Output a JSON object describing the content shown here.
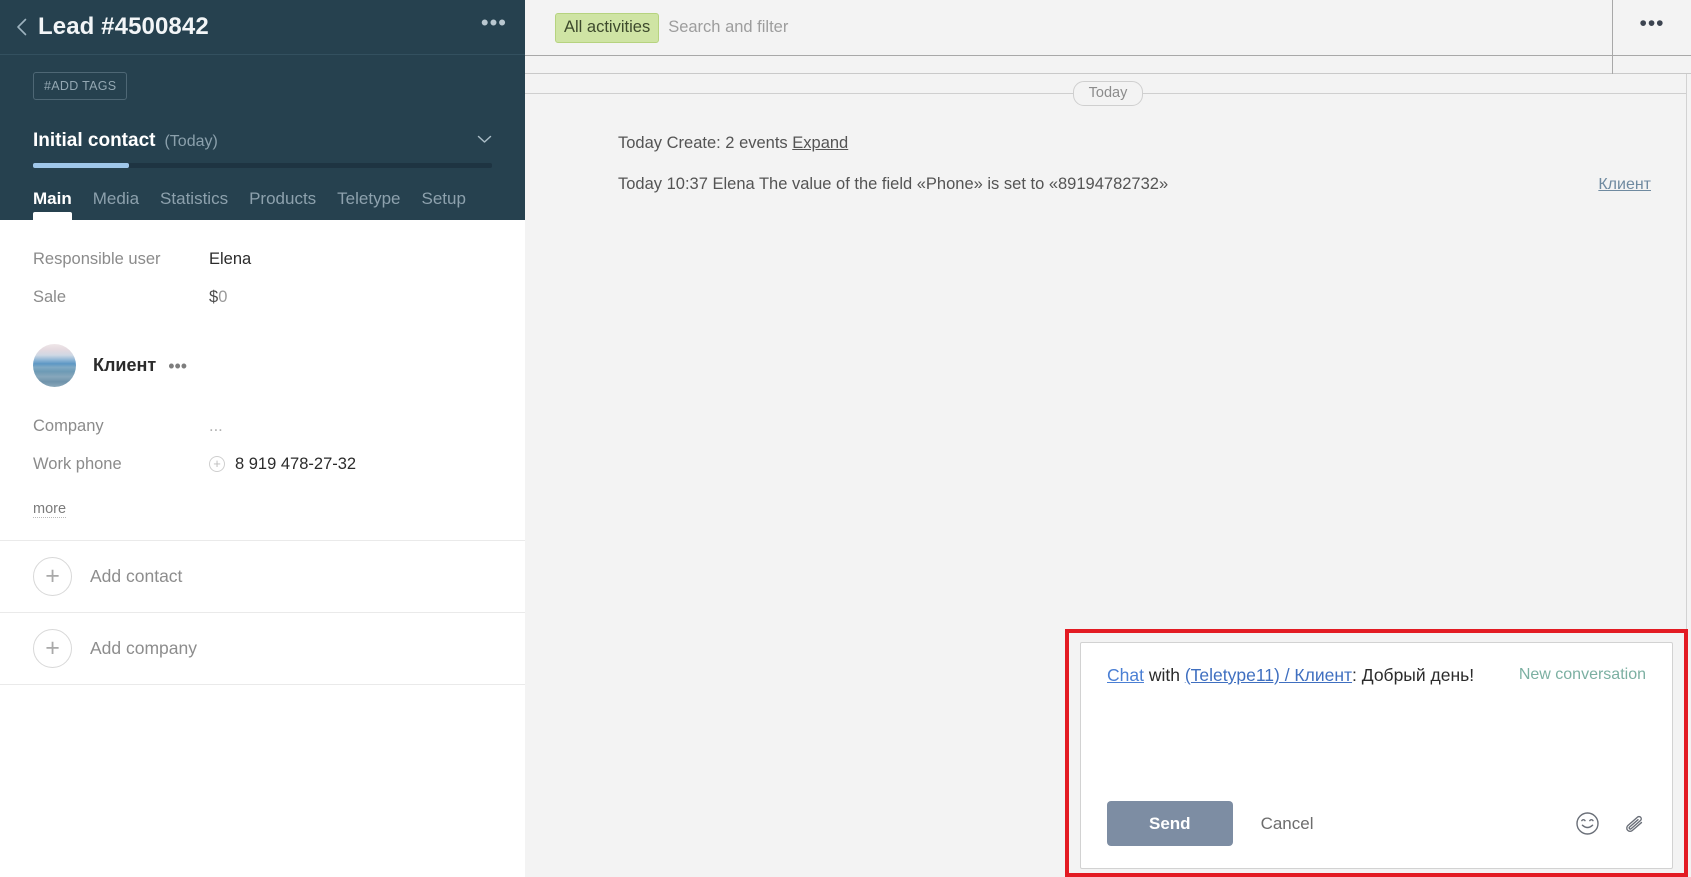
{
  "left_panel": {
    "back_icon": "chevron-left-icon",
    "title": "Lead #4500842",
    "more_dots": "•••",
    "add_tags_label": "#ADD TAGS",
    "stage": {
      "name": "Initial contact",
      "when": "(Today)",
      "chevron": "⌄",
      "progress_percent": 21
    },
    "tabs": [
      {
        "label": "Main",
        "active": true
      },
      {
        "label": "Media",
        "active": false
      },
      {
        "label": "Statistics",
        "active": false
      },
      {
        "label": "Products",
        "active": false
      },
      {
        "label": "Teletype",
        "active": false
      },
      {
        "label": "Setup",
        "active": false
      }
    ],
    "fields": [
      {
        "label": "Responsible user",
        "value": "Elena"
      },
      {
        "label": "Sale",
        "value": "$0"
      }
    ],
    "sale_currency": "$",
    "sale_amount": "0",
    "contact": {
      "name": "Клиент",
      "dots": "•••",
      "company_label": "Company",
      "company_value": "...",
      "phone_label": "Work phone",
      "phone_value": "8 919 478-27-32",
      "phone_add_icon": "plus-icon",
      "more_label": "more"
    },
    "add_contact_label": "Add contact",
    "add_company_label": "Add company",
    "plus_glyph": "+"
  },
  "topbar": {
    "filter_chip": "All activities",
    "search_placeholder": "Search and filter",
    "more_dots": "•••"
  },
  "timeline": {
    "day_pill": "Today",
    "events": [
      {
        "text": "Today Create: 2 events ",
        "link": "Expand",
        "right_link": ""
      },
      {
        "text": "Today 10:37 Elena The value of the field «Phone» is set to «89194782732»",
        "link": "",
        "right_link": "Клиент"
      }
    ]
  },
  "composer": {
    "chat_link": "Chat",
    "with_word": "with",
    "target_link": "(Teletype11) / Клиент",
    "separator": ": ",
    "message": "Добрый день!",
    "new_conversation": "New conversation",
    "send_label": "Send",
    "cancel_label": "Cancel",
    "emoji_icon": "smiley-icon",
    "attach_icon": "paperclip-icon",
    "highlight_color": "#e31b23"
  },
  "colors": {
    "sidebar_dark": "#26414f",
    "chip_green": "#cfe4a4",
    "progress_blue": "#9fc7ea",
    "send_button": "#7d8da3",
    "new_conversation": "#7cb0a2"
  }
}
